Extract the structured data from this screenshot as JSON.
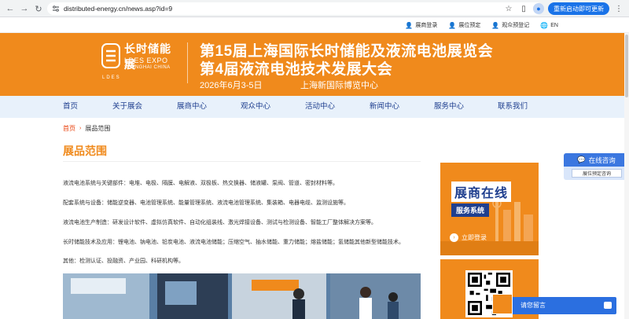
{
  "browser": {
    "url": "distributed-energy.cn/news.asp?id=9",
    "update_label": "重新启动即可更新",
    "avatar_letter": "●"
  },
  "topbar": {
    "links": [
      {
        "icon": "user-icon",
        "label": "展商登录"
      },
      {
        "icon": "user-icon",
        "label": "展位预定"
      },
      {
        "icon": "user-plus-icon",
        "label": "观众预登记"
      },
      {
        "icon": "globe-icon",
        "label": "EN"
      }
    ]
  },
  "banner": {
    "logo_cn": "长时储能展",
    "logo_en": "LDES EXPO",
    "logo_city": "SHANGHAI CHINA",
    "logo_abbr": "LDES",
    "title_line1": "第15届上海国际长时储能及液流电池展览会",
    "title_line2": "第4届液流电池技术发展大会",
    "date": "2026年6月3-5日",
    "venue": "上海新国际博览中心",
    "bg_color": "#f08a1c"
  },
  "nav": {
    "items": [
      "首页",
      "关于展会",
      "展商中心",
      "观众中心",
      "活动中心",
      "新闻中心",
      "服务中心",
      "联系我们"
    ]
  },
  "breadcrumb": {
    "home": "首页",
    "separator": "›",
    "current": "展品范围"
  },
  "page_title": "展品范围",
  "content": {
    "paragraphs": [
      "液流电池系统与关键部件：电堆、电极、隔膜、电解液、双极板、热交换器、储液罐、泵阀、管道、密封材料等。",
      "配套系统与设备：储能逆变器、电池管理系统、能量管理系统、液流电池管理系统、集装箱、电器电缆、监测设施等。",
      "液流电池生产制造：研发设计软件、虚拟仿真软件、自动化组装线、激光焊接设备、测试与检测设备、智能工厂整体解决方案等。",
      "长时储能技术及应用：锂电池、钠电池、铅炭电池、液流电池储能；压缩空气、抽水储能、重力储能；熔盐储能；氢储能其他新型储能技术。",
      "其他：检测认证、投融资、产业园、科研机构等。"
    ]
  },
  "sidebar": {
    "promo_title": "展商在线",
    "promo_sub": "服务系统",
    "login_label": "立即登录"
  },
  "float_panel": {
    "head": "在线咨询",
    "button": "展位预定咨询"
  },
  "chat": {
    "label": "请您留言"
  }
}
